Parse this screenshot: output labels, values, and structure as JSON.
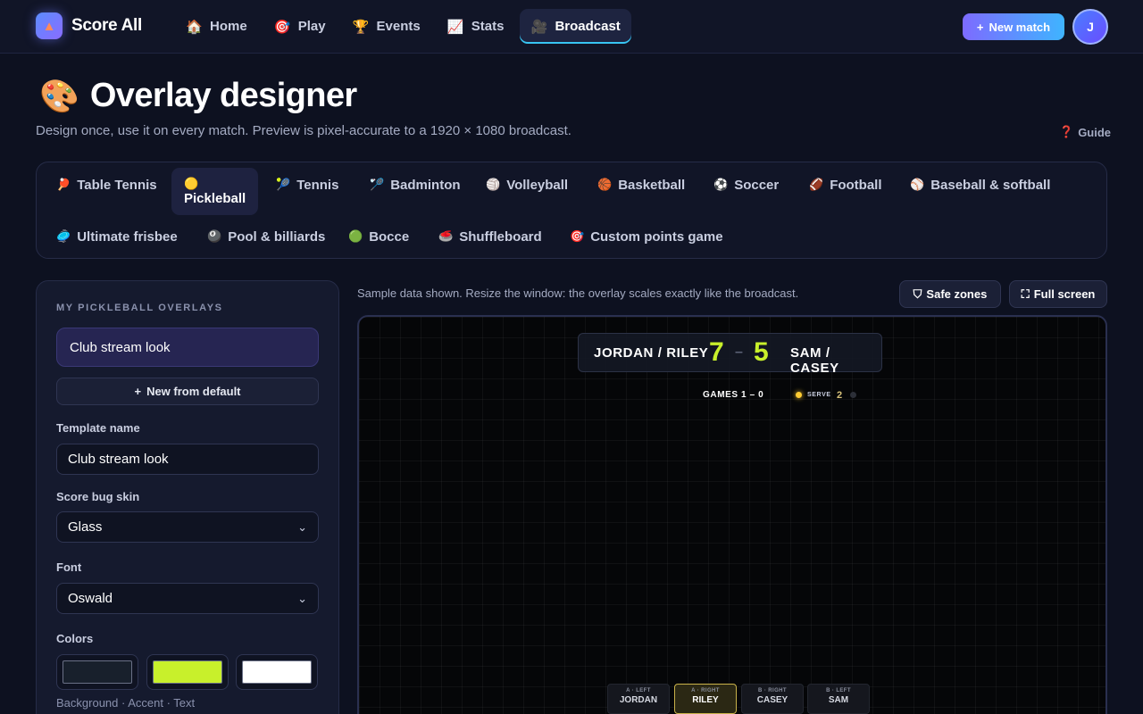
{
  "app": {
    "name": "Score All"
  },
  "nav": [
    {
      "label": "Home",
      "icon": "house-icon"
    },
    {
      "label": "Play",
      "icon": "target-icon"
    },
    {
      "label": "Events",
      "icon": "trophy-icon"
    },
    {
      "label": "Stats",
      "icon": "chart-icon"
    },
    {
      "label": "Broadcast",
      "icon": "video-camera-icon",
      "active": true
    }
  ],
  "header": {
    "new_match_label": "New match",
    "avatar_initial": "J"
  },
  "page": {
    "title": "Overlay designer",
    "subtitle": "Design once, use it on every match. Preview is pixel-accurate to a 1920 × 1080 broadcast.",
    "guide_label": "Guide"
  },
  "sports": [
    {
      "label": "Table Tennis"
    },
    {
      "label": "Pickleball",
      "active": true
    },
    {
      "label": "Tennis"
    },
    {
      "label": "Badminton"
    },
    {
      "label": "Volleyball"
    },
    {
      "label": "Basketball"
    },
    {
      "label": "Soccer"
    },
    {
      "label": "Football"
    },
    {
      "label": "Baseball & softball"
    },
    {
      "label": "Ultimate frisbee"
    },
    {
      "label": "Pool & billiards"
    },
    {
      "label": "Bocce"
    },
    {
      "label": "Shuffleboard"
    },
    {
      "label": "Custom points game"
    }
  ],
  "panel": {
    "heading": "MY PICKLEBALL OVERLAYS",
    "overlays": [
      "Club stream look"
    ],
    "new_from_default_label": "New from default",
    "template_name_label": "Template name",
    "template_name_value": "Club stream look",
    "skin_label": "Score bug skin",
    "skin_value": "Glass",
    "font_label": "Font",
    "font_value": "Oswald",
    "colors_label": "Colors",
    "colors": {
      "background": "#18202c",
      "accent": "#c8f02b",
      "text": "#ffffff"
    },
    "colors_caption": "Background · Accent · Text"
  },
  "preview": {
    "note": "Sample data shown. Resize the window: the overlay scales exactly like the broadcast.",
    "safe_zones_label": "Safe zones",
    "full_screen_label": "Full screen",
    "bug": {
      "left_team": "JORDAN / RILEY",
      "left_score": "7",
      "separator": "–",
      "right_score": "5",
      "right_team": "SAM / CASEY"
    },
    "games": "GAMES 1 – 0",
    "serve_label": "SERVE",
    "serve_number": "2",
    "positions": [
      {
        "key": "A · LEFT",
        "name": "JORDAN"
      },
      {
        "key": "A · RIGHT",
        "name": "RILEY",
        "active": true
      },
      {
        "key": "B · RIGHT",
        "name": "CASEY"
      },
      {
        "key": "B · LEFT",
        "name": "SAM"
      }
    ]
  }
}
